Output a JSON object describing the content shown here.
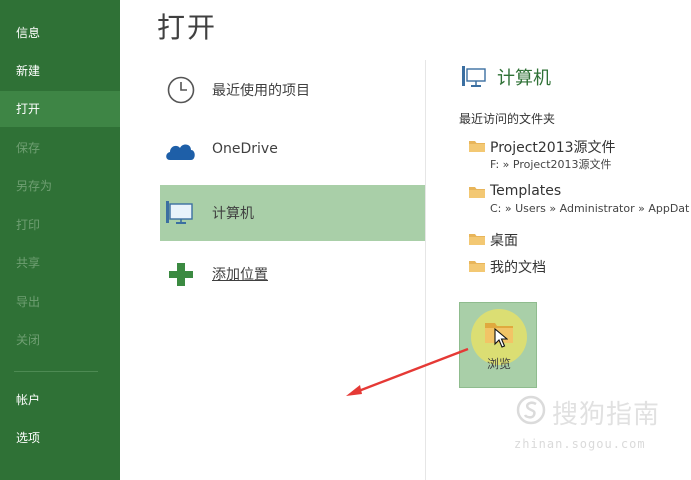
{
  "sidebar": {
    "items": [
      {
        "label": "信息",
        "state": "enabled"
      },
      {
        "label": "新建",
        "state": "enabled"
      },
      {
        "label": "打开",
        "state": "active"
      },
      {
        "label": "保存",
        "state": "disabled"
      },
      {
        "label": "另存为",
        "state": "disabled"
      },
      {
        "label": "打印",
        "state": "disabled"
      },
      {
        "label": "共享",
        "state": "disabled"
      },
      {
        "label": "导出",
        "state": "disabled"
      },
      {
        "label": "关闭",
        "state": "disabled"
      },
      {
        "label": "帐户",
        "state": "enabled"
      },
      {
        "label": "选项",
        "state": "enabled"
      }
    ]
  },
  "page": {
    "title": "打开"
  },
  "locations": [
    {
      "label": "最近使用的项目",
      "icon": "clock-icon"
    },
    {
      "label": "OneDrive",
      "icon": "cloud-icon"
    },
    {
      "label": "计算机",
      "icon": "computer-icon",
      "selected": true
    },
    {
      "label": "添加位置",
      "icon": "plus-icon"
    }
  ],
  "right_panel": {
    "title": "计算机",
    "section_label": "最近访问的文件夹",
    "folders": [
      {
        "name": "Project2013源文件",
        "path": "F: » Project2013源文件"
      },
      {
        "name": "Templates",
        "path": "C: » Users » Administrator » AppDat"
      },
      {
        "name": "桌面"
      },
      {
        "name": "我的文档"
      }
    ],
    "browse_label": "浏览"
  },
  "watermark": {
    "text": "搜狗指南",
    "sub": "zhinan.sogou.com"
  },
  "colors": {
    "sidebar_bg": "#2f7136",
    "selected_bg": "#a9cfa8",
    "accent_text": "#2f7136",
    "arrow": "#e53935"
  }
}
